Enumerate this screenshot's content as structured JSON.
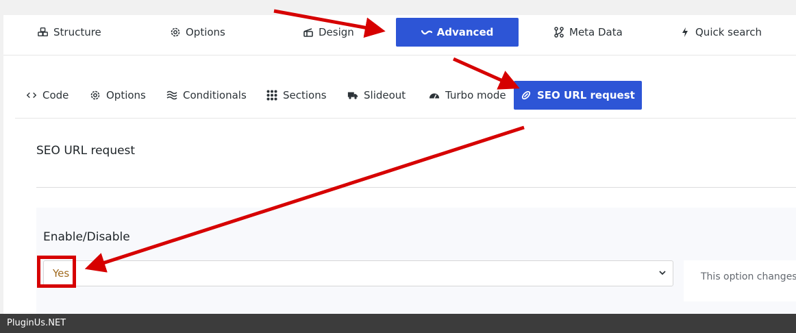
{
  "main_tabs": [
    {
      "label": "Structure",
      "icon": "cubes-icon"
    },
    {
      "label": "Options",
      "icon": "gear-icon"
    },
    {
      "label": "Design",
      "icon": "design-icon"
    },
    {
      "label": "Advanced",
      "icon": "wave-icon",
      "active": true
    },
    {
      "label": "Meta Data",
      "icon": "nodes-icon"
    },
    {
      "label": "Quick search",
      "icon": "bolt-icon"
    }
  ],
  "sub_tabs": [
    {
      "label": "Code",
      "icon": "code-icon"
    },
    {
      "label": "Options",
      "icon": "gear-icon"
    },
    {
      "label": "Conditionals",
      "icon": "waves-icon"
    },
    {
      "label": "Sections",
      "icon": "grid-icon"
    },
    {
      "label": "Slideout",
      "icon": "truck-icon"
    },
    {
      "label": "Turbo mode",
      "icon": "gauge-icon"
    },
    {
      "label": "SEO URL request",
      "icon": "link-icon",
      "active": true
    }
  ],
  "section": {
    "title": "SEO URL request"
  },
  "option": {
    "label": "Enable/Disable",
    "selected_value": "Yes",
    "description": "This option changes"
  },
  "footer": {
    "text": "PluginUs.NET"
  },
  "colors": {
    "accent": "#2d55d6",
    "annotation_red": "#d60000",
    "select_text": "#a06a1e"
  }
}
